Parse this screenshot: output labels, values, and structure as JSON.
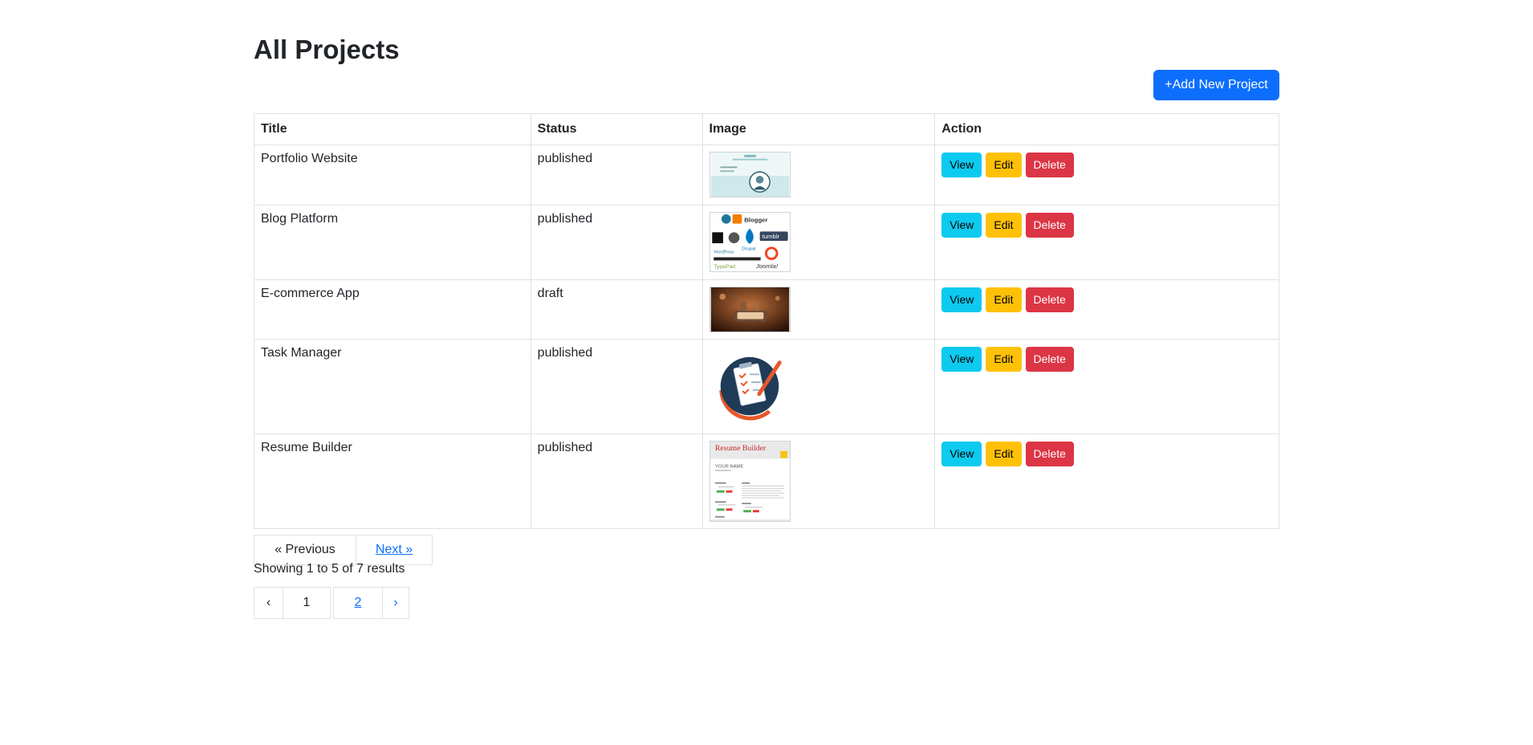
{
  "page": {
    "title": "All Projects",
    "add_button": "+Add New Project"
  },
  "table": {
    "headers": [
      "Title",
      "Status",
      "Image",
      "Action"
    ],
    "rows": [
      {
        "title": "Portfolio Website",
        "status": "published",
        "image": "portfolio-website-thumbnail"
      },
      {
        "title": "Blog Platform",
        "status": "published",
        "image": "blog-platform-logos-thumbnail"
      },
      {
        "title": "E-commerce App",
        "status": "draft",
        "image": "ecommerce-phone-thumbnail"
      },
      {
        "title": "Task Manager",
        "status": "published",
        "image": "task-manager-clipboard-thumbnail"
      },
      {
        "title": "Resume Builder",
        "status": "published",
        "image": "resume-builder-thumbnail"
      }
    ],
    "actions": {
      "view": "View",
      "edit": "Edit",
      "delete": "Delete"
    }
  },
  "thumb_text": {
    "blog": [
      "Blogger",
      "tumblr",
      "Drupal",
      "WordPress",
      "TypePad",
      "Joomla!"
    ],
    "resume_title": "Resume Builder",
    "resume_name": "YOUR NAME"
  },
  "pagination": {
    "previous": "« Previous",
    "next": "Next »",
    "showing": "Showing 1 to 5 of 7 results",
    "prev_arrow": "‹",
    "next_arrow": "›",
    "pages": [
      "1",
      "2"
    ]
  },
  "colors": {
    "primary": "#0d6efd",
    "info": "#0dcaf0",
    "warning": "#ffc107",
    "danger": "#dc3545",
    "border": "#dee2e6"
  }
}
